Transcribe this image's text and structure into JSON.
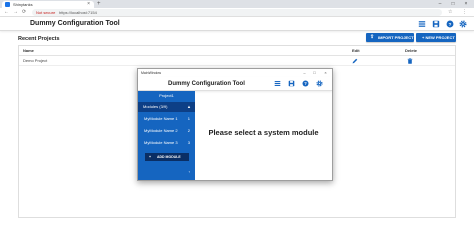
{
  "browser": {
    "tab_title": "Shinytanks",
    "tab_close": "×",
    "new_tab": "+",
    "minimize": "–",
    "maximize": "□",
    "close": "×",
    "back": "←",
    "forward": "→",
    "reload": "⟳",
    "security_label": "Not secure",
    "url": "https://localhost:7154",
    "star": "☆",
    "menu": "⋮"
  },
  "app": {
    "title": "Dummy Configuration Tool"
  },
  "main": {
    "section_title": "Recent Projects",
    "import_label": "IMPORT PROJECT",
    "new_label": "+ NEW PROJECT",
    "table": {
      "columns": [
        "Name",
        "Edit",
        "Delete"
      ],
      "rows": [
        {
          "name": "Demo Project"
        }
      ]
    }
  },
  "window": {
    "title": "MainWindow",
    "minimize": "–",
    "maximize": "□",
    "close": "×",
    "app_title": "Dummy Configuration Tool",
    "project_label": "Project1",
    "modules_header": "Modules (3/9)",
    "modules_chevron": "▲",
    "modules": [
      {
        "label": "MyModule Name 1",
        "num": "1"
      },
      {
        "label": "MyModule Name 2",
        "num": "2"
      },
      {
        "label": "MyModule Name 3",
        "num": "3"
      }
    ],
    "add_module_label": "ADD MODULE",
    "add_module_plus": "+",
    "collapse_icon": "‹",
    "placeholder": "Please select a system module"
  },
  "colors": {
    "accent": "#1565c0",
    "sidebar_dark": "#0d3f86"
  }
}
